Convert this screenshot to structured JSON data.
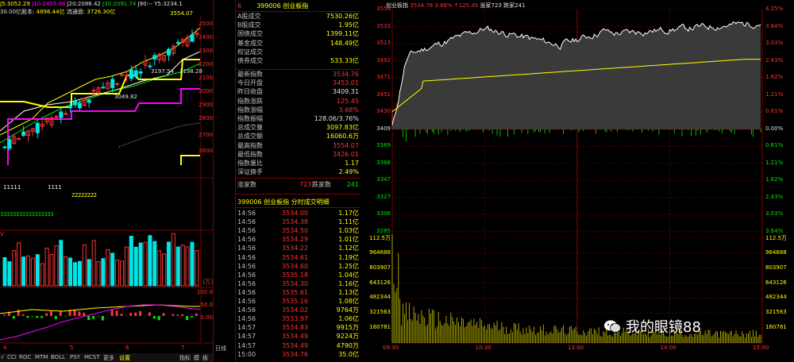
{
  "left": {
    "ma_line": {
      "ma5": "J5:3052.29",
      "ma10": "J10:2455.98",
      "ma20": "J20:2086.42",
      "ma30": "J30:2091.74",
      "ma90": "J90:--",
      "y5": "Y5:3234.1"
    },
    "cap_line": {
      "total": "30.00亿股本:",
      "total_val": "4896.44亿",
      "float_label": "流通盘:",
      "float_val": "3726.30亿"
    },
    "price_high_label": "3554.07",
    "price_levels": [
      "3197.54",
      "3198.28",
      "3049.82"
    ],
    "y_ticks": [
      "2500",
      "2400",
      "2300",
      "2200",
      "2100",
      "2000",
      "2900",
      "2800",
      "2700",
      "2600"
    ],
    "y_ticks_ordered": [
      "2500",
      "2400",
      "2300",
      "2200",
      "2100",
      "2000",
      "2900",
      "2800",
      "2700",
      "2600"
    ],
    "vol_unit": "[万]",
    "vol_label": "V",
    "ind_ticks": [
      "100.0",
      "50.0",
      "0.00"
    ],
    "x_labels": [
      "4",
      "5",
      "6",
      "7"
    ],
    "tabs": [
      "√",
      "CCI",
      "ROC",
      "MTM",
      "BOLL",
      "PSY",
      "MCST",
      "更多",
      "设置"
    ],
    "tab_right": [
      "指标",
      "模",
      "板"
    ],
    "period_label": "日线",
    "indicator_rows": {
      "r1": "11111",
      "r2": "1111",
      "r3": "22222222",
      "r4": "33333333333333333"
    }
  },
  "mid": {
    "header_code_prefix": "6",
    "header_code": "399006",
    "header_name": "创业板指",
    "stats1": [
      {
        "label": "A股成交",
        "value": "7530.26亿",
        "color": "yellow"
      },
      {
        "label": "B股成交",
        "value": "1.95亿",
        "color": "yellow"
      },
      {
        "label": "国债成交",
        "value": "1399.11亿",
        "color": "yellow"
      },
      {
        "label": "基金成交",
        "value": "148.49亿",
        "color": "yellow"
      },
      {
        "label": "权证成交",
        "value": "",
        "color": "yellow"
      },
      {
        "label": "债券成交",
        "value": "533.33亿",
        "color": "yellow"
      }
    ],
    "stats2": [
      {
        "label": "最新指数",
        "value": "3534.76",
        "color": "red"
      },
      {
        "label": "今日开盘",
        "value": "3453.01",
        "color": "red"
      },
      {
        "label": "昨日收盘",
        "value": "3409.31",
        "color": "white"
      },
      {
        "label": "指数涨跌",
        "value": "125.45",
        "color": "red"
      },
      {
        "label": "指数涨幅",
        "value": "3.68%",
        "color": "red"
      },
      {
        "label": "指数振幅",
        "value": "128.06/3.76%",
        "color": "white"
      },
      {
        "label": "总成交量",
        "value": "3097.83亿",
        "color": "yellow"
      },
      {
        "label": "总成交额",
        "value": "16060.6万",
        "color": "yellow"
      },
      {
        "label": "最高指数",
        "value": "3554.07",
        "color": "red"
      },
      {
        "label": "最低指数",
        "value": "3426.01",
        "color": "red"
      },
      {
        "label": "指数量比",
        "value": "1.17",
        "color": "yellow"
      },
      {
        "label": "深证换手",
        "value": "2.49%",
        "color": "yellow"
      }
    ],
    "updown": {
      "up_label": "涨家数",
      "up_val": "723",
      "down_label": "跌家数",
      "down_val": "241"
    },
    "trades_title_code": "399006",
    "trades_title_name": "创业板指",
    "trades_title_rest": "分时成交明细",
    "trades": [
      {
        "t": "14:56",
        "p": "3534.00",
        "v": "1.17亿"
      },
      {
        "t": "14:56",
        "p": "3534.38",
        "v": "1.11亿"
      },
      {
        "t": "14:56",
        "p": "3534.50",
        "v": "1.03亿"
      },
      {
        "t": "14:56",
        "p": "3534.29",
        "v": "1.01亿"
      },
      {
        "t": "14:56",
        "p": "3534.22",
        "v": "1.12亿"
      },
      {
        "t": "14:56",
        "p": "3534.61",
        "v": "1.19亿"
      },
      {
        "t": "14:56",
        "p": "3534.60",
        "v": "1.25亿"
      },
      {
        "t": "14:56",
        "p": "3535.18",
        "v": "1.04亿"
      },
      {
        "t": "14:56",
        "p": "3534.30",
        "v": "1.16亿"
      },
      {
        "t": "14:56",
        "p": "3535.61",
        "v": "1.13亿"
      },
      {
        "t": "14:56",
        "p": "3535.16",
        "v": "1.08亿"
      },
      {
        "t": "14:56",
        "p": "3534.02",
        "v": "9764万"
      },
      {
        "t": "14:56",
        "p": "3533.97",
        "v": "1.06亿"
      },
      {
        "t": "14:57",
        "p": "3534.83",
        "v": "9915万"
      },
      {
        "t": "14:57",
        "p": "3534.49",
        "v": "9224万"
      },
      {
        "t": "14:57",
        "p": "3534.49",
        "v": "4790万"
      },
      {
        "t": "15:00",
        "p": "3534.76",
        "v": "35.0亿"
      }
    ]
  },
  "right": {
    "header": {
      "name": "创业板指",
      "price": "3534.78",
      "pct": "3.68%",
      "chg": "↑125.45",
      "up": "涨家723",
      "down": "跌家241"
    },
    "price_ticks_left": [
      "3554",
      "3533",
      "3513",
      "3492",
      "3471",
      "3451",
      "3430",
      "3409",
      "3389",
      "3368",
      "3347",
      "3327",
      "3306",
      "3285"
    ],
    "pct_ticks_right": [
      "4.25%",
      "3.64%",
      "3.03%",
      "2.43%",
      "1.82%",
      "1.21%",
      "0.61%",
      "0.00%",
      "0.61%",
      "1.21%",
      "1.82%",
      "2.43%",
      "3.03%",
      "3.64%"
    ],
    "vol_ticks": [
      "112.5万",
      "964688",
      "803907",
      "643126",
      "482344",
      "321563",
      "160781"
    ],
    "time_labels": [
      "09:30",
      "10:30",
      "13:00",
      "14:00",
      "15:00"
    ],
    "watermark": "我的眼镜88",
    "colors": {
      "up": "#ff3232",
      "down": "#00e600",
      "avg": "#ffff00",
      "grid": "#800000"
    }
  }
}
